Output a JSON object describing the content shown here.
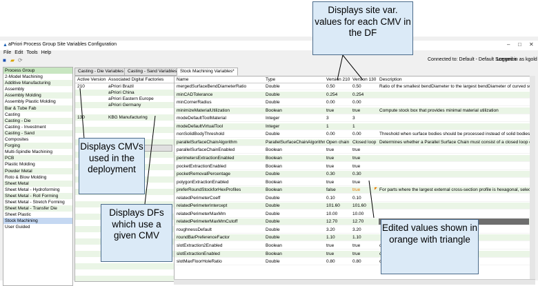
{
  "window": {
    "title": "aPriori Process Group Site Variables Configuration",
    "icon": "apriori-logo-icon"
  },
  "menu": [
    "File",
    "Edit",
    "Tools",
    "Help"
  ],
  "status": {
    "connected": "Connected to: Default - Default Scenarios",
    "login": "Logged in as kgold"
  },
  "process_groups": {
    "header": "Process Group",
    "items": [
      "2-Model Machining",
      "Additive Manufacturing",
      "Assembly",
      "Assembly Molding",
      "Assembly Plastic Molding",
      "Bar & Tube Fab",
      "Casting",
      "Casting - Die",
      "Casting - Investment",
      "Casting - Sand",
      "Composites",
      "Forging",
      "Multi-Spindle Machining",
      "PCB",
      "Plastic Molding",
      "Powder Metal",
      "Roto & Blow Molding",
      "Sheet Metal",
      "Sheet Metal - Hydroforming",
      "Sheet Metal - Roll Forming",
      "Sheet Metal - Stretch Forming",
      "Sheet Metal - Transfer Die",
      "Sheet Plastic",
      "Stock Machining",
      "User Guided"
    ],
    "selected": "Stock Machining"
  },
  "tabs": [
    "Casting - Die Variables",
    "Casting - Sand Variables",
    "Stock Machining Variables*"
  ],
  "active_tab": "Stock Machining Variables*",
  "versions": {
    "col_version": "Active Version",
    "col_factories": "Associated Digital Factories",
    "rows": [
      {
        "version": "210",
        "factory": "aPriori Brazil"
      },
      {
        "version": "",
        "factory": "aPriori China"
      },
      {
        "version": "",
        "factory": "aPriori Eastern Europe"
      },
      {
        "version": "",
        "factory": "aPriori Germany"
      },
      {
        "version": "130",
        "factory": "KBG Manufacturing"
      }
    ],
    "more_label": "more >>"
  },
  "variables": {
    "columns": [
      "Name",
      "Type",
      "Version 210",
      "Version 130",
      "Description"
    ],
    "rows": [
      {
        "name": "mergedSurfaceBendDiameterRatio",
        "type": "Double",
        "v210": "0.50",
        "v130": "0.50",
        "desc": "Ratio of the smallest bendDiameter to the largest bendDiameter of curved surfac"
      },
      {
        "name": "minCADTolerance",
        "type": "Double",
        "v210": "0.254",
        "v130": "0.254",
        "desc": ""
      },
      {
        "name": "minCornerRadius",
        "type": "Double",
        "v210": "0.00",
        "v130": "0.00",
        "desc": ""
      },
      {
        "name": "minimizeMaterialUtilization",
        "type": "Boolean",
        "v210": "true",
        "v130": "true",
        "desc": "Compute stock box that provides minimal material utilization"
      },
      {
        "name": "modeDefaultToolMaterial",
        "type": "Integer",
        "v210": "3",
        "v130": "3",
        "desc": ""
      },
      {
        "name": "modeDefaultVirtualTool",
        "type": "Integer",
        "v210": "1",
        "v130": "1",
        "desc": ""
      },
      {
        "name": "nonSolidBodyThreshold",
        "type": "Double",
        "v210": "0.00",
        "v130": "0.00",
        "desc": "Threshold when surface bodies should be processed instead of solid bodies"
      },
      {
        "name": "parallelSurfaceChainAlgorithm",
        "type": "ParallelSurfaceChainAlgorithm",
        "v210": "Open chain",
        "v130": "Closed loop",
        "desc": "Determines whether a Parallel Surface Chain must consist of a closed loop of par"
      },
      {
        "name": "parallelSurfaceChainEnabled",
        "type": "Boolean",
        "v210": "true",
        "v130": "true",
        "desc": ""
      },
      {
        "name": "perimetersExtractionEnabled",
        "type": "Boolean",
        "v210": "true",
        "v130": "true",
        "desc": ""
      },
      {
        "name": "pocketExtractionEnabled",
        "type": "Boolean",
        "v210": "true",
        "v130": "true",
        "desc": ""
      },
      {
        "name": "pocketRemovalPercentage",
        "type": "Double",
        "v210": "0.30",
        "v130": "0.30",
        "desc": ""
      },
      {
        "name": "polygonExtractionEnabled",
        "type": "Boolean",
        "v210": "true",
        "v130": "true",
        "desc": ""
      },
      {
        "name": "preferRoundStockforHexProfiles",
        "type": "Boolean",
        "v210": "false",
        "v130": "true",
        "desc": "For parts where the largest external cross-section profile is hexagonal, select Hex",
        "edited_v130": true
      },
      {
        "name": "relatedPerimeterCoeff",
        "type": "Double",
        "v210": "0.10",
        "v130": "0.10",
        "desc": ""
      },
      {
        "name": "relatedPerimeterIntercept",
        "type": "Double",
        "v210": "101.60",
        "v130": "101.60",
        "desc": ""
      },
      {
        "name": "relatedPerimeterMaxMm",
        "type": "Double",
        "v210": "10.00",
        "v130": "10.00",
        "desc": ""
      },
      {
        "name": "relatedPerimeterMaxMmCutoff",
        "type": "Double",
        "v210": "12.70",
        "v130": "12.70",
        "desc": "",
        "dark_desc": true
      },
      {
        "name": "roughnessDefault",
        "type": "Double",
        "v210": "3.20",
        "v130": "3.20",
        "desc": ""
      },
      {
        "name": "roundBarPreferenceFactor",
        "type": "Double",
        "v210": "1.10",
        "v130": "1.10",
        "desc": ""
      },
      {
        "name": "slotExtraction2Enabled",
        "type": "Boolean",
        "v210": "true",
        "v130": "true",
        "desc": "ot geometries"
      },
      {
        "name": "slotExtractionEnabled",
        "type": "Boolean",
        "v210": "true",
        "v130": "true",
        "desc": "o true, Slot GCDs will be extr"
      },
      {
        "name": "slotMaxFloorHoleRatio",
        "type": "Double",
        "v210": "0.80",
        "v130": "0.80",
        "desc": "carded.  Specifically slots are"
      }
    ]
  },
  "callouts": {
    "site_values": "Displays site var. values for each CMV in the DF",
    "cmvs": "Displays CMVs used in the deployment",
    "dfs": "Displays DFs which use a given CMV",
    "edited": "Edited values shown in orange with triangle"
  },
  "colors": {
    "list_stripe": "#eaf5e6",
    "selection": "#c5d8f2",
    "callout_fill": "#dbeaf7",
    "edited_value": "#e87a00"
  }
}
